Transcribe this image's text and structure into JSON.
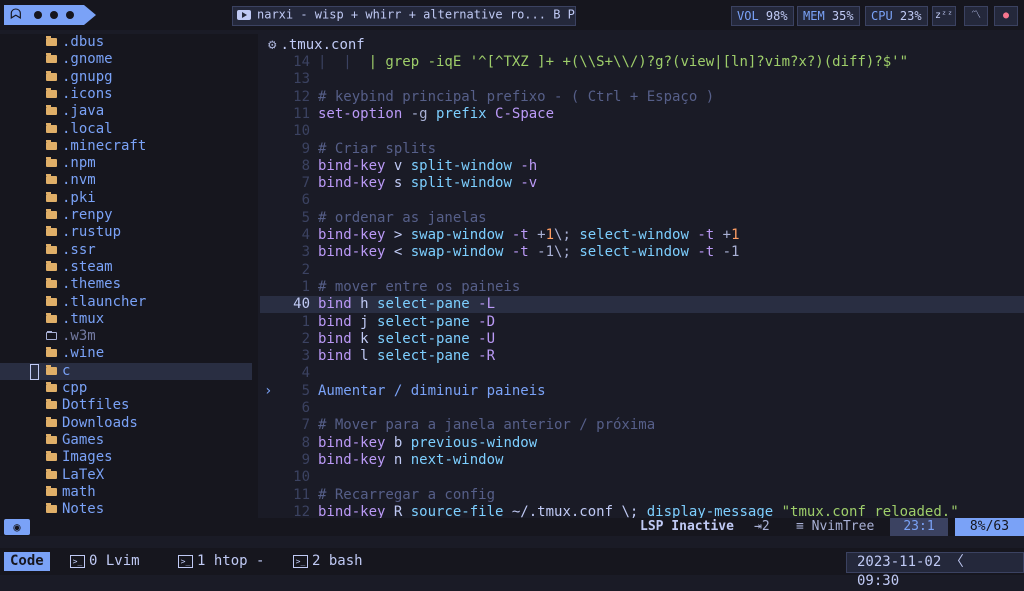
{
  "topbar": {
    "ghost_glyph": "ᗣ",
    "media_title": "narxi - wisp + whirr + alternative ro... B P N",
    "vol_label": "VOL",
    "vol_value": "98%",
    "mem_label": "MEM",
    "mem_value": "35%",
    "cpu_label": "CPU",
    "cpu_value": "23%",
    "sleep_glyph": "zᶻᶻ",
    "wave_glyph": "〽",
    "record_glyph": "●"
  },
  "sidebar": {
    "items": [
      {
        "name": ".dbus",
        "dim": false
      },
      {
        "name": ".gnome",
        "dim": false
      },
      {
        "name": ".gnupg",
        "dim": false
      },
      {
        "name": ".icons",
        "dim": false
      },
      {
        "name": ".java",
        "dim": false
      },
      {
        "name": ".local",
        "dim": false
      },
      {
        "name": ".minecraft",
        "dim": false
      },
      {
        "name": ".npm",
        "dim": false
      },
      {
        "name": ".nvm",
        "dim": false
      },
      {
        "name": ".pki",
        "dim": false
      },
      {
        "name": ".renpy",
        "dim": false
      },
      {
        "name": ".rustup",
        "dim": false
      },
      {
        "name": ".ssr",
        "dim": false
      },
      {
        "name": ".steam",
        "dim": false
      },
      {
        "name": ".themes",
        "dim": false
      },
      {
        "name": ".tlauncher",
        "dim": false
      },
      {
        "name": ".tmux",
        "dim": false
      },
      {
        "name": ".w3m",
        "dim": true,
        "open": true
      },
      {
        "name": ".wine",
        "dim": false
      },
      {
        "name": "c",
        "dim": false,
        "selected": true
      },
      {
        "name": "cpp",
        "dim": false
      },
      {
        "name": "Dotfiles",
        "dim": false
      },
      {
        "name": "Downloads",
        "dim": false
      },
      {
        "name": "Games",
        "dim": false
      },
      {
        "name": "Images",
        "dim": false
      },
      {
        "name": "LaTeX",
        "dim": false
      },
      {
        "name": "math",
        "dim": false
      },
      {
        "name": "Notes",
        "dim": false
      }
    ]
  },
  "editor": {
    "filename": ".tmux.conf",
    "lines": [
      {
        "n": "14",
        "cur": false,
        "tokens": [
          [
            "guide",
            "|  |  "
          ],
          [
            "c-grn",
            "| grep -iqE '^[^TXZ ]+ +(\\\\S+\\\\/)?g?(view|[ln]?vim?x?)(diff)?$'\""
          ]
        ]
      },
      {
        "n": "13",
        "cur": false,
        "tokens": []
      },
      {
        "n": "12",
        "cur": false,
        "tokens": [
          [
            "c-com",
            "# keybind principal prefixo - ( Ctrl + Espaço )"
          ]
        ]
      },
      {
        "n": "11",
        "cur": false,
        "tokens": [
          [
            "c-kw",
            "set-option"
          ],
          [
            "c-op",
            " -g "
          ],
          [
            "c-fn",
            "prefix"
          ],
          [
            "c-op",
            " "
          ],
          [
            "c-kw",
            "C-Space"
          ]
        ]
      },
      {
        "n": "10",
        "cur": false,
        "tokens": []
      },
      {
        "n": "9",
        "cur": false,
        "tokens": [
          [
            "c-com",
            "# Criar splits"
          ]
        ]
      },
      {
        "n": "8",
        "cur": false,
        "tokens": [
          [
            "c-kw",
            "bind-key"
          ],
          [
            "c-pl",
            " v "
          ],
          [
            "c-fn",
            "split-window"
          ],
          [
            "c-kw",
            " -h"
          ]
        ]
      },
      {
        "n": "7",
        "cur": false,
        "tokens": [
          [
            "c-kw",
            "bind-key"
          ],
          [
            "c-pl",
            " s "
          ],
          [
            "c-fn",
            "split-window"
          ],
          [
            "c-kw",
            " -v"
          ]
        ]
      },
      {
        "n": "6",
        "cur": false,
        "tokens": []
      },
      {
        "n": "5",
        "cur": false,
        "tokens": [
          [
            "c-com",
            "# ordenar as janelas"
          ]
        ]
      },
      {
        "n": "4",
        "cur": false,
        "tokens": [
          [
            "c-kw",
            "bind-key"
          ],
          [
            "c-pl",
            " > "
          ],
          [
            "c-fn",
            "swap-window"
          ],
          [
            "c-kw",
            " -t "
          ],
          [
            "c-op",
            "+"
          ],
          [
            "c-num",
            "1"
          ],
          [
            "c-op",
            "\\; "
          ],
          [
            "c-fn",
            "select-window"
          ],
          [
            "c-kw",
            " -t "
          ],
          [
            "c-op",
            "+"
          ],
          [
            "c-num",
            "1"
          ]
        ]
      },
      {
        "n": "3",
        "cur": false,
        "tokens": [
          [
            "c-kw",
            "bind-key"
          ],
          [
            "c-pl",
            " < "
          ],
          [
            "c-fn",
            "swap-window"
          ],
          [
            "c-kw",
            " -t "
          ],
          [
            "c-op",
            "-1\\; "
          ],
          [
            "c-fn",
            "select-window"
          ],
          [
            "c-kw",
            " -t "
          ],
          [
            "c-op",
            "-1"
          ]
        ]
      },
      {
        "n": "2",
        "cur": false,
        "tokens": []
      },
      {
        "n": "1",
        "cur": false,
        "tokens": [
          [
            "c-com",
            "# mover entre os paineis"
          ]
        ]
      },
      {
        "n": "40",
        "cur": true,
        "tokens": [
          [
            "c-kw",
            "bind"
          ],
          [
            "c-pl",
            " h "
          ],
          [
            "c-fn",
            "select-pane"
          ],
          [
            "c-kw",
            " -L"
          ]
        ]
      },
      {
        "n": "1",
        "cur": false,
        "tokens": [
          [
            "c-kw",
            "bind"
          ],
          [
            "c-pl",
            " j "
          ],
          [
            "c-fn",
            "select-pane"
          ],
          [
            "c-kw",
            " -D"
          ]
        ]
      },
      {
        "n": "2",
        "cur": false,
        "tokens": [
          [
            "c-kw",
            "bind"
          ],
          [
            "c-pl",
            " k "
          ],
          [
            "c-fn",
            "select-pane"
          ],
          [
            "c-kw",
            " -U"
          ]
        ]
      },
      {
        "n": "3",
        "cur": false,
        "tokens": [
          [
            "c-kw",
            "bind"
          ],
          [
            "c-pl",
            " l "
          ],
          [
            "c-fn",
            "select-pane"
          ],
          [
            "c-kw",
            " -R"
          ]
        ]
      },
      {
        "n": "4",
        "cur": false,
        "tokens": []
      },
      {
        "n": "5",
        "cur": false,
        "fold": "›",
        "tokens": [
          [
            "c-blu",
            "Aumentar / diminuir paineis"
          ]
        ]
      },
      {
        "n": "6",
        "cur": false,
        "tokens": []
      },
      {
        "n": "7",
        "cur": false,
        "tokens": [
          [
            "c-com",
            "# Mover para a janela anterior / próxima"
          ]
        ]
      },
      {
        "n": "8",
        "cur": false,
        "tokens": [
          [
            "c-kw",
            "bind-key"
          ],
          [
            "c-pl",
            " b "
          ],
          [
            "c-fn",
            "previous-window"
          ]
        ]
      },
      {
        "n": "9",
        "cur": false,
        "tokens": [
          [
            "c-kw",
            "bind-key"
          ],
          [
            "c-pl",
            " n "
          ],
          [
            "c-fn",
            "next-window"
          ]
        ]
      },
      {
        "n": "10",
        "cur": false,
        "tokens": []
      },
      {
        "n": "11",
        "cur": false,
        "tokens": [
          [
            "c-com",
            "# Recarregar a config"
          ]
        ]
      },
      {
        "n": "12",
        "cur": false,
        "tokens": [
          [
            "c-kw",
            "bind-key"
          ],
          [
            "c-pl",
            " R "
          ],
          [
            "c-fn",
            "source-file"
          ],
          [
            "c-pl",
            " ~/.tmux.conf \\; "
          ],
          [
            "c-fn",
            "display-message"
          ],
          [
            "c-pl",
            " "
          ],
          [
            "c-str",
            "\"tmux.conf reloaded.\""
          ]
        ]
      }
    ]
  },
  "statusline": {
    "left_glyph": "◉",
    "lsp": "LSP Inactive",
    "buffers": "⇥2",
    "tree": "≡ NvimTree",
    "position": "23:1",
    "percent": "8%/63"
  },
  "tmux": {
    "session": "Code",
    "windows": [
      {
        "label": "0 Lvim"
      },
      {
        "label": "1 htop -"
      },
      {
        "label": "2 bash"
      }
    ],
    "clock": "2023-11-02 〈 09:30"
  }
}
